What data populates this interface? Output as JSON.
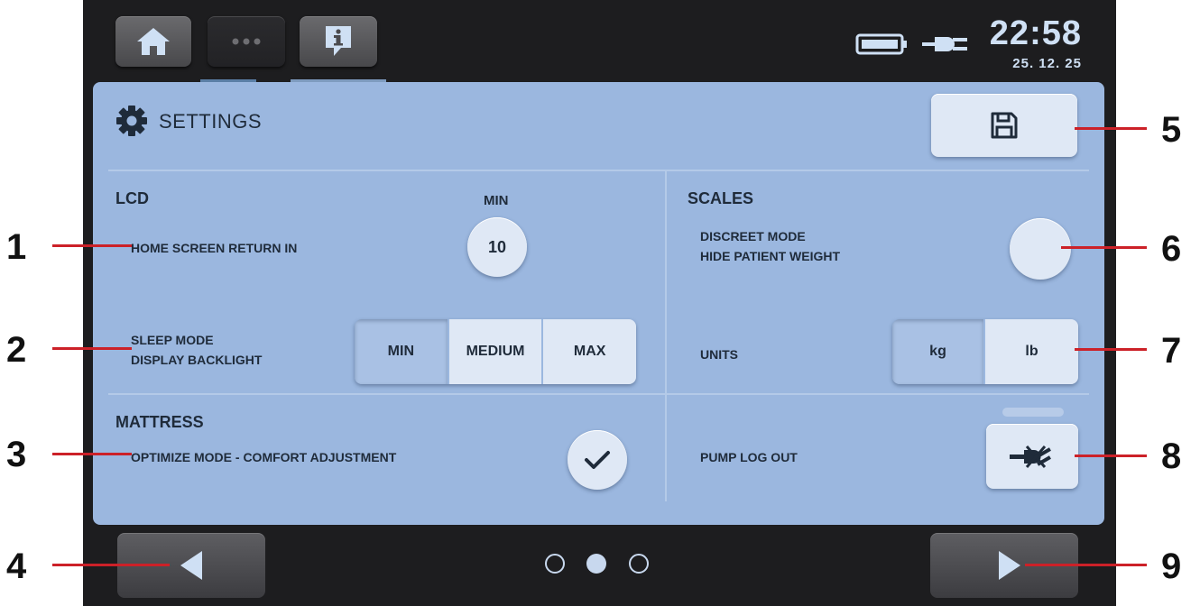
{
  "status_bar": {
    "time": "22:58",
    "date": "25. 12. 25"
  },
  "panel": {
    "title": "SETTINGS",
    "lcd": {
      "heading": "LCD",
      "unit_label": "MIN",
      "home_return_label": "HOME SCREEN RETURN IN",
      "home_return_value": "10",
      "sleep_label_line1": "SLEEP MODE",
      "sleep_label_line2": "DISPLAY BACKLIGHT",
      "backlight_options": [
        "MIN",
        "MEDIUM",
        "MAX"
      ],
      "backlight_selected": "MIN"
    },
    "scales": {
      "heading": "SCALES",
      "discreet_line1": "DISCREET MODE",
      "discreet_line2": "HIDE PATIENT WEIGHT",
      "units_label": "UNITS",
      "unit_options": [
        "kg",
        "lb"
      ],
      "unit_selected": "kg"
    },
    "mattress": {
      "heading": "MATTRESS",
      "optimize_label": "OPTIMIZE MODE - COMFORT ADJUSTMENT",
      "optimize_checked": true
    },
    "pump": {
      "logout_label": "PUMP LOG OUT"
    }
  },
  "pagination": {
    "pages": 3,
    "current": 2
  },
  "callouts": [
    "1",
    "2",
    "3",
    "4",
    "5",
    "6",
    "7",
    "8",
    "9"
  ],
  "colors": {
    "panel": "#9bb7df",
    "button": "#dfe8f5",
    "selected": "#a9c1e4",
    "callout_red": "#cc2128",
    "status_text": "#cfe0f4"
  },
  "icons": {
    "home": "home-icon",
    "more": "more-dots-icon",
    "info": "info-icon",
    "battery": "battery-icon",
    "plug": "power-plug-icon",
    "settings": "gear-icon",
    "save": "floppy-disk-icon",
    "check": "check-icon",
    "pump_logout": "pump-logout-icon",
    "prev": "left-arrow-icon",
    "next": "right-arrow-icon"
  }
}
